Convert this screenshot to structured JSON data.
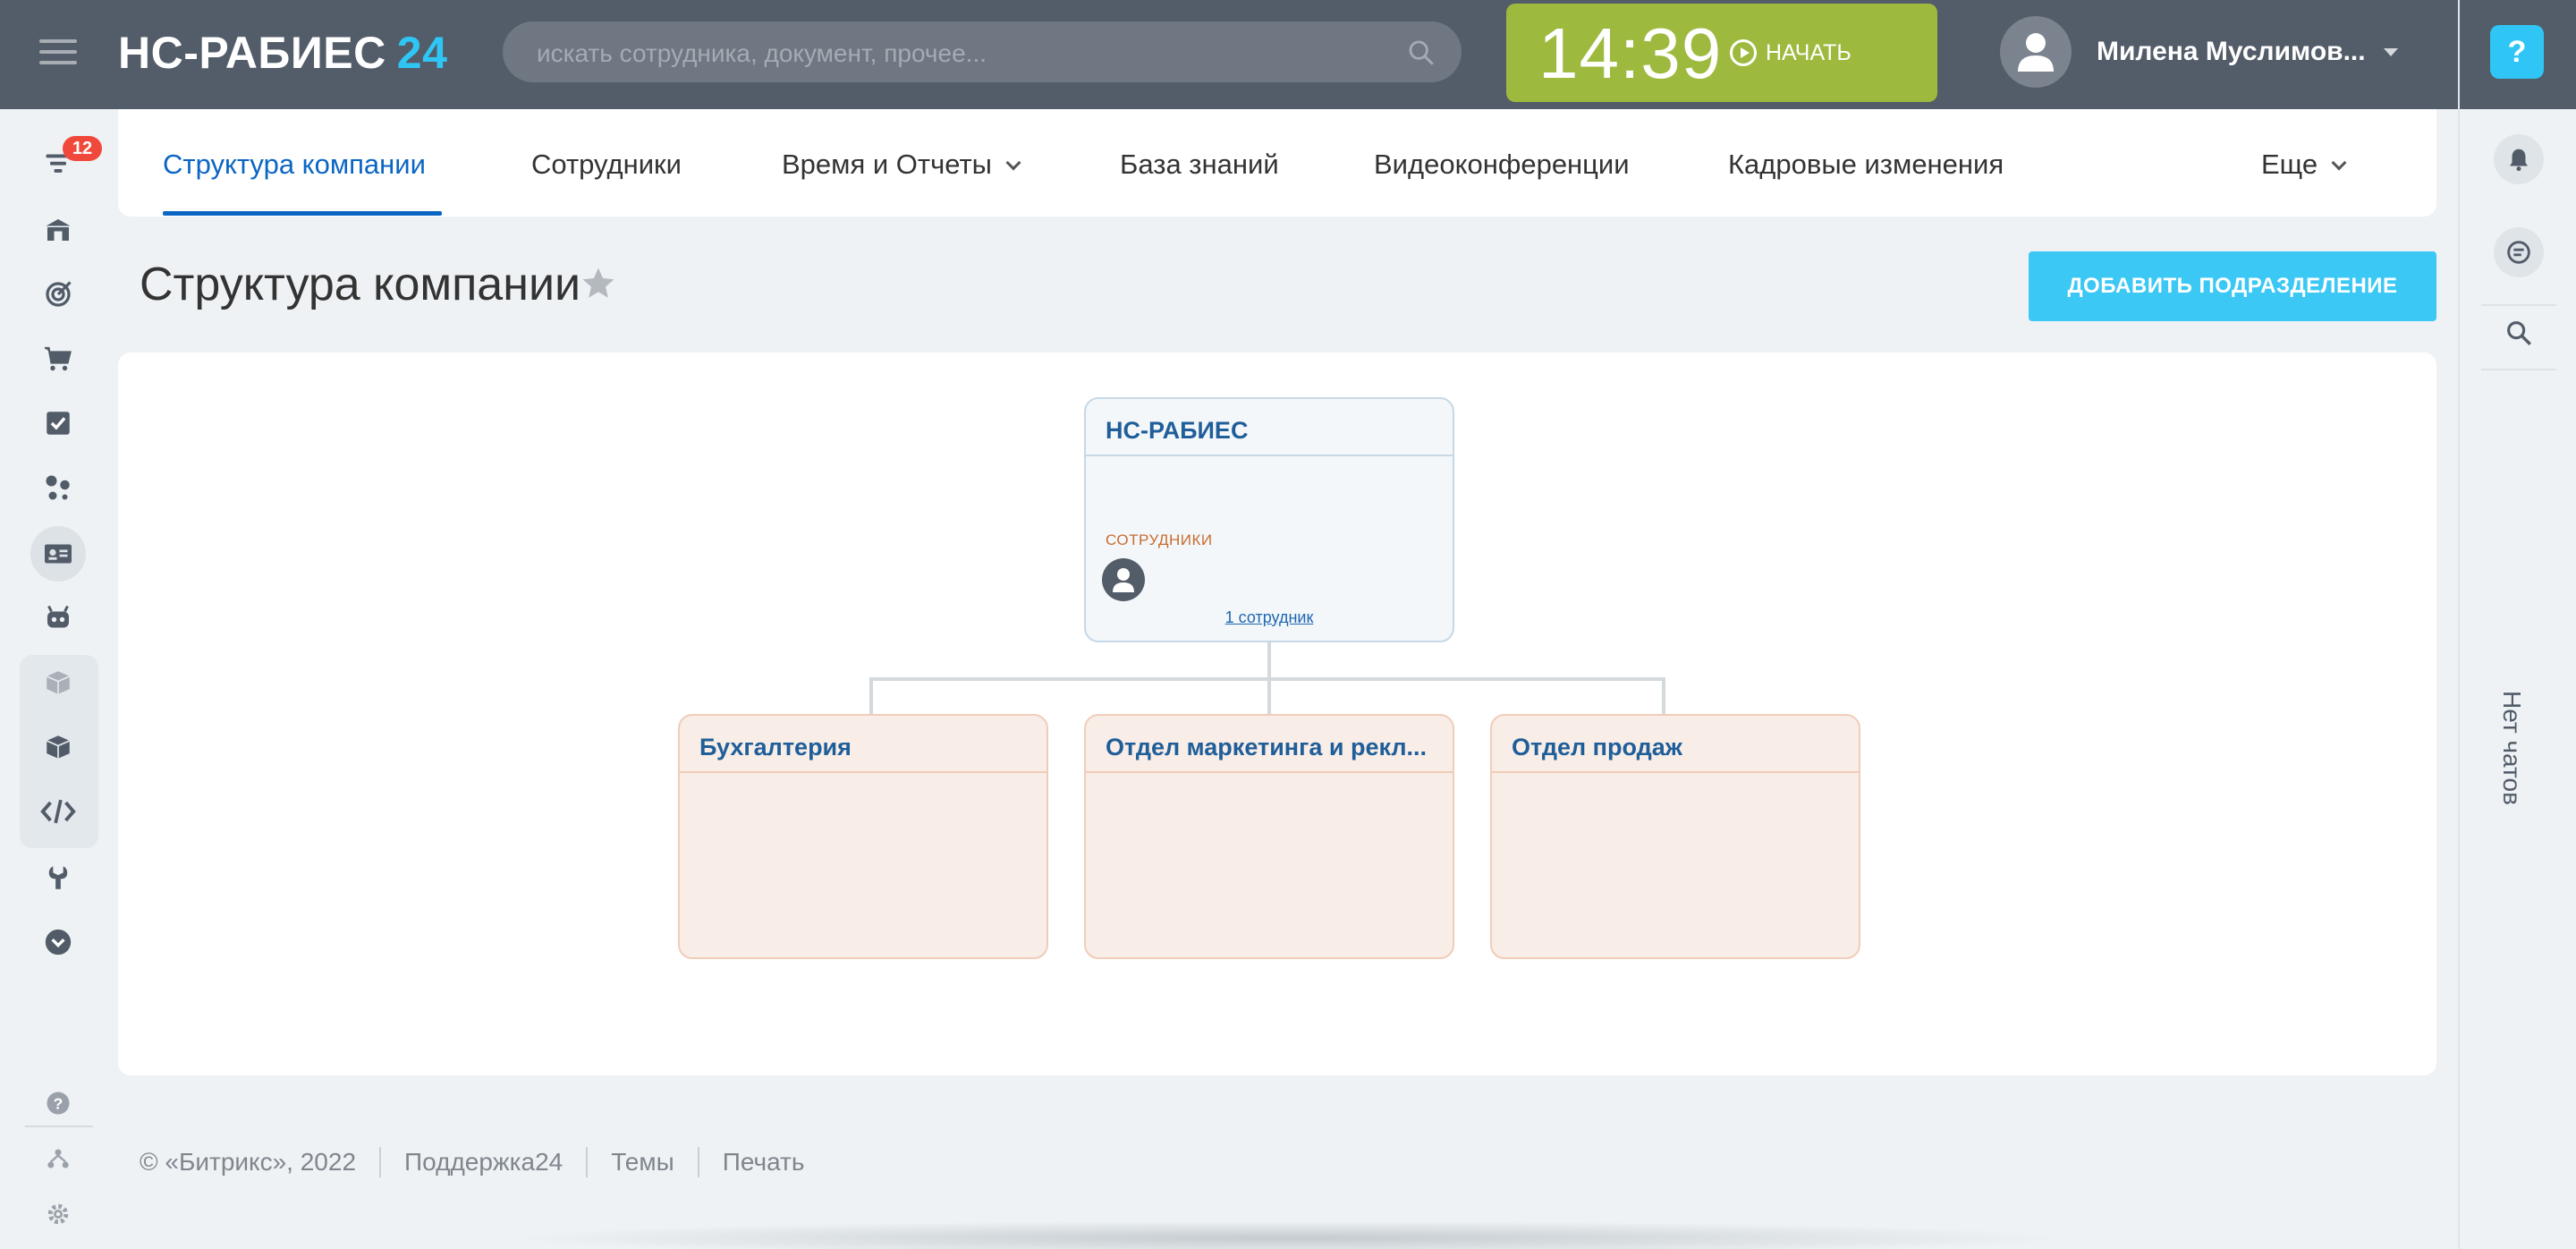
{
  "header": {
    "logo_text": "НС-РАБИЕС",
    "logo_num": "24",
    "search_placeholder": "искать сотрудника, документ, прочее...",
    "clock_time": "14:39",
    "start_label": "НАЧАТЬ",
    "user_name": "Милена Муслимов...",
    "help_label": "?"
  },
  "sidebar": {
    "badge_count": "12",
    "items": [
      "filter-icon",
      "bank-icon",
      "target-icon",
      "cart-icon",
      "checkbox-icon",
      "network-icon",
      "contact-card-icon",
      "robot-icon",
      "box-icon",
      "box-dark-icon",
      "code-icon",
      "wrench-icon",
      "chevron-down-circle-icon",
      "question-icon",
      "sitemap-icon",
      "gear-icon"
    ]
  },
  "tabs": [
    {
      "label": "Структура компании"
    },
    {
      "label": "Сотрудники"
    },
    {
      "label": "Время и Отчеты"
    },
    {
      "label": "База знаний"
    },
    {
      "label": "Видеоконференции"
    },
    {
      "label": "Кадровые изменения"
    },
    {
      "label": "Еще"
    }
  ],
  "page": {
    "title": "Структура компании",
    "add_button": "ДОБАВИТЬ ПОДРАЗДЕЛЕНИЕ"
  },
  "structure": {
    "root": {
      "title": "НС-РАБИЕС",
      "employees_label": "СОТРУДНИКИ",
      "employees_count": "1 сотрудник"
    },
    "children": [
      {
        "title": "Бухгалтерия"
      },
      {
        "title": "Отдел маркетинга и рекл..."
      },
      {
        "title": "Отдел продаж"
      }
    ]
  },
  "right_panel": {
    "no_chats": "Нет чатов"
  },
  "footer": {
    "copyright": "© «Битрикс», 2022",
    "support": "Поддержка24",
    "themes": "Темы",
    "print": "Печать"
  },
  "colors": {
    "header_bg": "#535c69",
    "accent_blue": "#2fc6f6",
    "clock_green": "#9dba3f",
    "active_tab": "#0b66c3",
    "badge_red": "#f0493b"
  }
}
